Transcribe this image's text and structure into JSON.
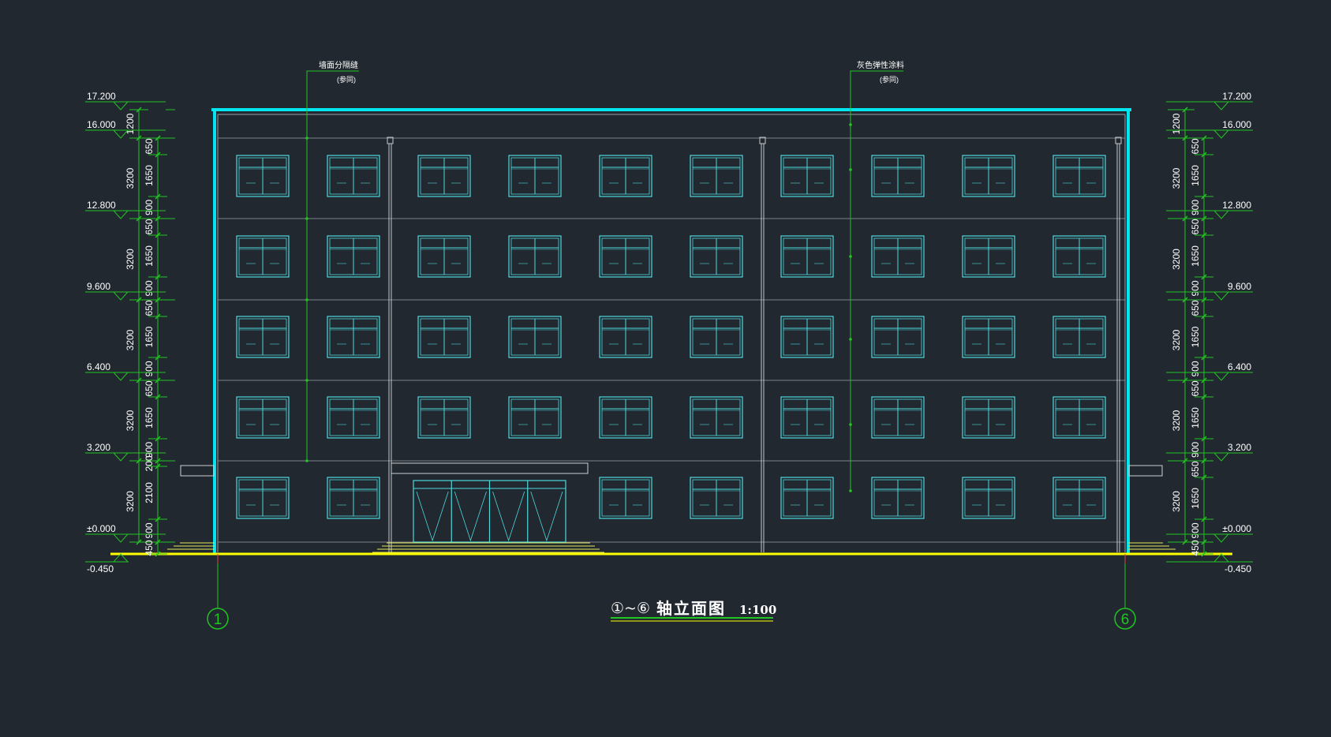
{
  "colors": {
    "background": "#212830",
    "outline": "#00e5ee",
    "window": "#4fd8dc",
    "grid": "#9aa0a6",
    "dimension": "#22c522",
    "ground": "#ffff00",
    "steps": "#e8e85a",
    "axis_tick": "#e04040",
    "text": "#ffffff"
  },
  "annotations": {
    "left_label": "墙面分隔缝",
    "left_sub": "(参同)",
    "right_label": "灰色弹性涂料",
    "right_sub": "(参同)"
  },
  "title": {
    "prefix": "①~⑥",
    "text": "轴立面图",
    "scale": "1:100"
  },
  "axis_labels": {
    "left": "1",
    "right": "6"
  },
  "elevations": {
    "left": [
      "17.200",
      "16.000",
      "12.800",
      "9.600",
      "6.400",
      "3.200",
      "±0.000",
      "-0.450"
    ],
    "right": [
      "17.200",
      "16.000",
      "12.800",
      "9.600",
      "6.400",
      "3.200",
      "±0.000",
      "-0.450"
    ]
  },
  "dims_left_outer": [
    "1200",
    "3200",
    "3200",
    "3200",
    "3200",
    "3200"
  ],
  "dims_left_inner": [
    "650",
    "1650",
    "900",
    "650",
    "1650",
    "900",
    "650",
    "1650",
    "900",
    "650",
    "1650",
    "900",
    "200",
    "2100",
    "900",
    "450"
  ],
  "dims_right_outer": [
    "1200",
    "3200",
    "3200",
    "3200",
    "3200",
    "3200"
  ],
  "dims_right_inner": [
    "650",
    "1650",
    "900",
    "650",
    "1650",
    "900",
    "650",
    "1650",
    "900",
    "650",
    "1650",
    "900",
    "650",
    "1650",
    "900",
    "450"
  ]
}
